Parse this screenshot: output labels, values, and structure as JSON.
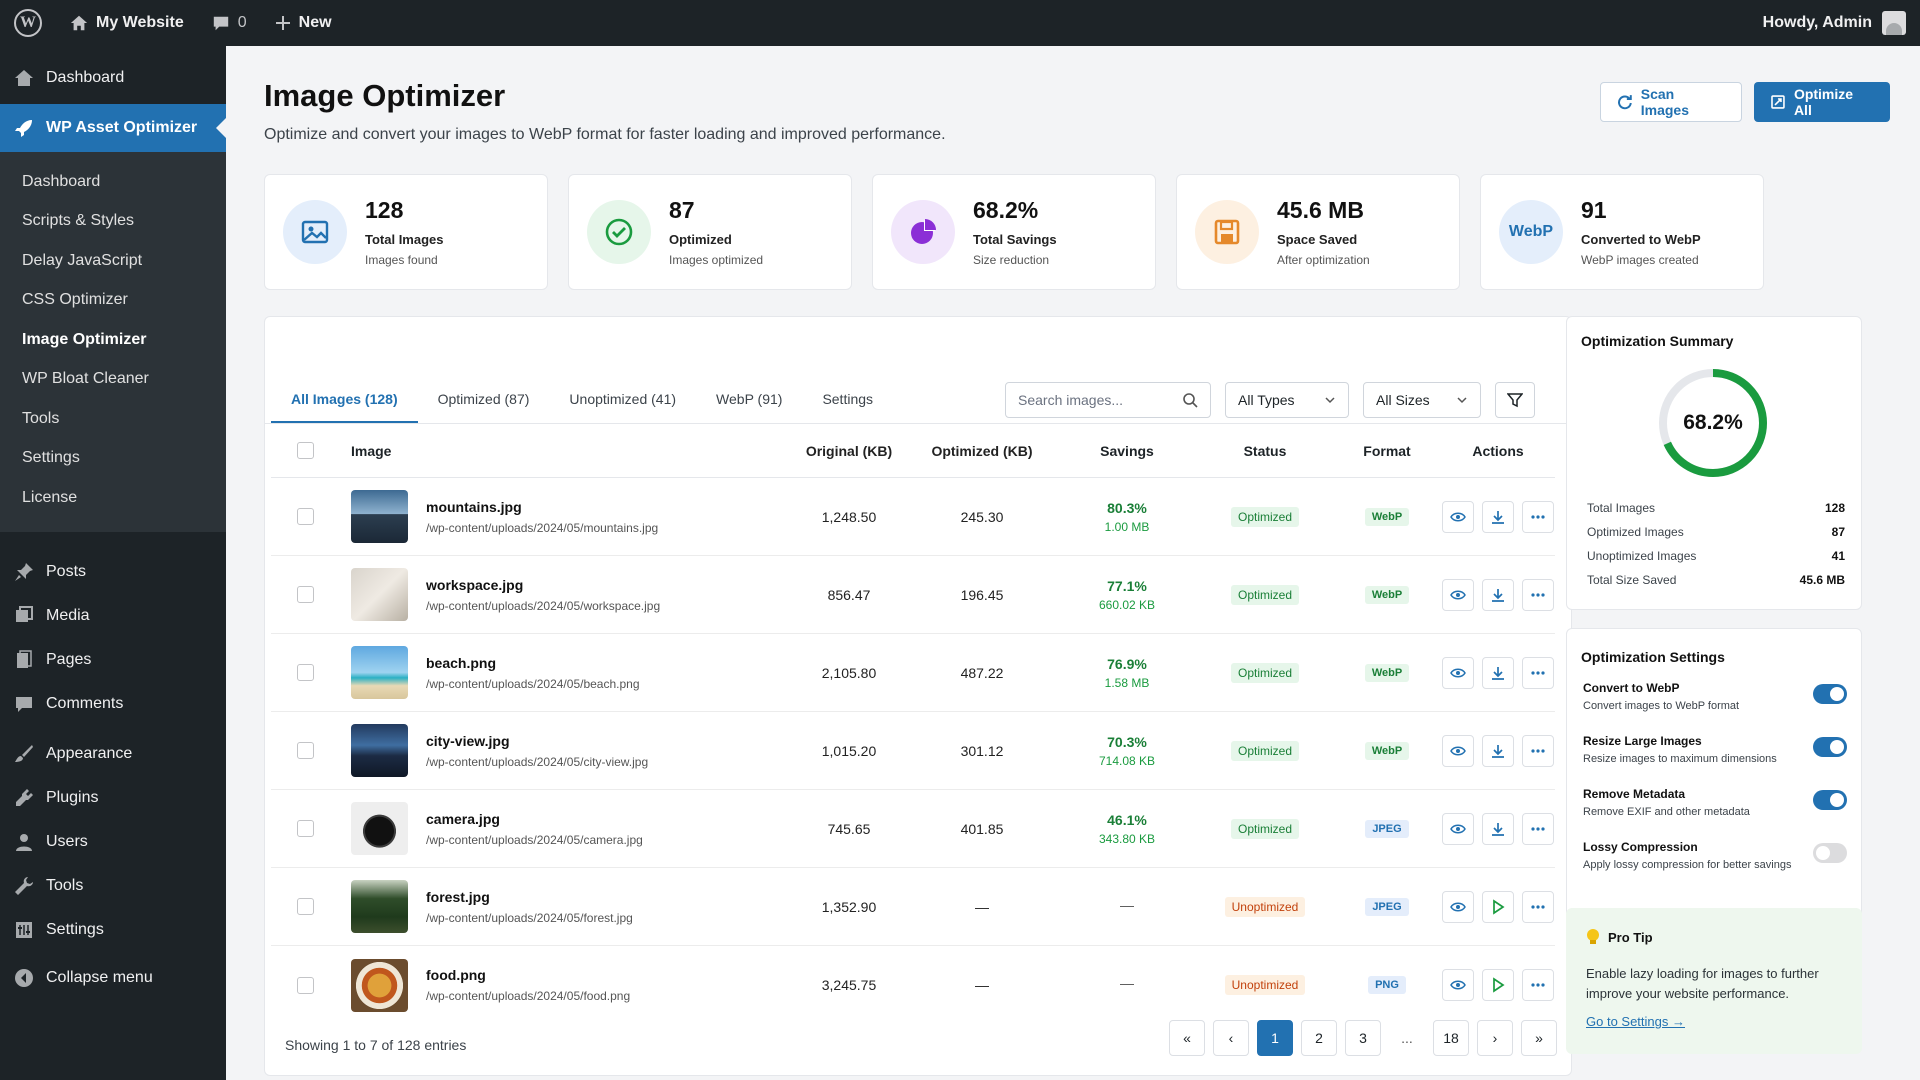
{
  "adminbar": {
    "site_name": "My Website",
    "comments_count": "0",
    "new_label": "New",
    "howdy": "Howdy, Admin"
  },
  "sidebar": {
    "dashboard": "Dashboard",
    "plugin": "WP Asset Optimizer",
    "sub_items": [
      "Dashboard",
      "Scripts & Styles",
      "Delay JavaScript",
      "CSS Optimizer",
      "Image Optimizer",
      "WP Bloat Cleaner",
      "Tools",
      "Settings",
      "License"
    ],
    "menu": [
      "Posts",
      "Media",
      "Pages",
      "Comments",
      "Appearance",
      "Plugins",
      "Users",
      "Tools",
      "Settings",
      "Collapse menu"
    ]
  },
  "page": {
    "title": "Image Optimizer",
    "description": "Optimize and convert your images to WebP format for faster loading and improved performance.",
    "scan_button": "Scan Images",
    "optimize_button": "Optimize All"
  },
  "stats": [
    {
      "value": "128",
      "label": "Total Images",
      "sub": "Images found",
      "icon": "image-icon",
      "color": "#2271b1",
      "bg": "#e4eefb"
    },
    {
      "value": "87",
      "label": "Optimized",
      "sub": "Images optimized",
      "icon": "check-circle-icon",
      "color": "#1a9b3f",
      "bg": "#e6f6ea"
    },
    {
      "value": "68.2%",
      "label": "Total Savings",
      "sub": "Size reduction",
      "icon": "pie-chart-icon",
      "color": "#8b2fd6",
      "bg": "#f1e6fb"
    },
    {
      "value": "45.6 MB",
      "label": "Space Saved",
      "sub": "After optimization",
      "icon": "save-icon",
      "color": "#e5892b",
      "bg": "#fdf0e1"
    },
    {
      "value": "91",
      "label": "Converted to WebP",
      "sub": "WebP images created",
      "icon": "webp-icon",
      "icon_text": "WebP",
      "color": "#2271b1",
      "bg": "#e4eefb"
    }
  ],
  "tabs": [
    "All Images (128)",
    "Optimized (87)",
    "Unoptimized (41)",
    "WebP (91)",
    "Settings"
  ],
  "filters": {
    "search_placeholder": "Search images...",
    "type": "All Types",
    "size": "All Sizes"
  },
  "table": {
    "headers": {
      "image": "Image",
      "original": "Original (KB)",
      "optimized": "Optimized (KB)",
      "savings": "Savings",
      "status": "Status",
      "format": "Format",
      "actions": "Actions"
    },
    "rows": [
      {
        "name": "mountains.jpg",
        "path": "/wp-content/uploads/2024/05/mountains.jpg",
        "original": "1,248.50",
        "optimized": "245.30",
        "pct": "80.3%",
        "amt": "1.00 MB",
        "status": "Optimized",
        "format": "WebP",
        "thumb": "mountains"
      },
      {
        "name": "workspace.jpg",
        "path": "/wp-content/uploads/2024/05/workspace.jpg",
        "original": "856.47",
        "optimized": "196.45",
        "pct": "77.1%",
        "amt": "660.02 KB",
        "status": "Optimized",
        "format": "WebP",
        "thumb": "workspace"
      },
      {
        "name": "beach.png",
        "path": "/wp-content/uploads/2024/05/beach.png",
        "original": "2,105.80",
        "optimized": "487.22",
        "pct": "76.9%",
        "amt": "1.58 MB",
        "status": "Optimized",
        "format": "WebP",
        "thumb": "beach"
      },
      {
        "name": "city-view.jpg",
        "path": "/wp-content/uploads/2024/05/city-view.jpg",
        "original": "1,015.20",
        "optimized": "301.12",
        "pct": "70.3%",
        "amt": "714.08 KB",
        "status": "Optimized",
        "format": "WebP",
        "thumb": "city"
      },
      {
        "name": "camera.jpg",
        "path": "/wp-content/uploads/2024/05/camera.jpg",
        "original": "745.65",
        "optimized": "401.85",
        "pct": "46.1%",
        "amt": "343.80 KB",
        "status": "Optimized",
        "format": "JPEG",
        "thumb": "camera"
      },
      {
        "name": "forest.jpg",
        "path": "/wp-content/uploads/2024/05/forest.jpg",
        "original": "1,352.90",
        "optimized": "—",
        "pct": "—",
        "amt": "",
        "status": "Unoptimized",
        "format": "JPEG",
        "thumb": "forest"
      },
      {
        "name": "food.png",
        "path": "/wp-content/uploads/2024/05/food.png",
        "original": "3,245.75",
        "optimized": "—",
        "pct": "—",
        "amt": "",
        "status": "Unoptimized",
        "format": "PNG",
        "thumb": "food"
      }
    ],
    "entries": "Showing 1 to 7 of 128 entries",
    "pages": [
      "«",
      "‹",
      "1",
      "2",
      "3",
      "...",
      "18",
      "›",
      "»"
    ],
    "current_page": "1"
  },
  "summary": {
    "title": "Optimization Summary",
    "percent_label": "68.2%",
    "percent": 68.2,
    "rows": [
      {
        "label": "Total Images",
        "value": "128"
      },
      {
        "label": "Optimized Images",
        "value": "87"
      },
      {
        "label": "Unoptimized Images",
        "value": "41"
      },
      {
        "label": "Total Size Saved",
        "value": "45.6 MB"
      }
    ]
  },
  "settings": {
    "title": "Optimization Settings",
    "items": [
      {
        "title": "Convert to WebP",
        "desc": "Convert images to WebP format",
        "on": true
      },
      {
        "title": "Resize Large Images",
        "desc": "Resize images to maximum dimensions",
        "on": true
      },
      {
        "title": "Remove Metadata",
        "desc": "Remove EXIF and other metadata",
        "on": true
      },
      {
        "title": "Lossy Compression",
        "desc": "Apply lossy compression for better savings",
        "on": false
      }
    ]
  },
  "tip": {
    "title": "Pro Tip",
    "text": "Enable lazy loading for images to further improve your website performance.",
    "link": "Go to Settings →"
  },
  "colors": {
    "accent": "#2271b1",
    "success": "#1a9b3f",
    "warning": "#c2410c",
    "admin_dark": "#1d2327"
  }
}
